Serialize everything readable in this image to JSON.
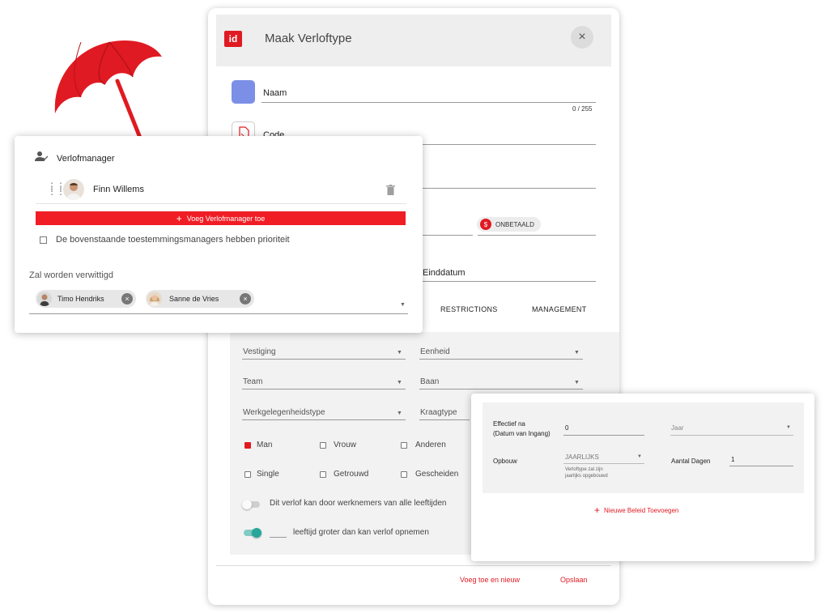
{
  "dialog": {
    "brand": "id",
    "title": "Maak Verloftype",
    "close_icon": "×",
    "naam_label": "Naam",
    "naam_counter": "0 / 255",
    "code_label": "Code",
    "unpaid_label": "ONBETAALD",
    "unpaid_icon": "$",
    "end_date_label": "Einddatum",
    "tabs": {
      "restrictions": "RESTRICTIONS",
      "management": "MANAGEMENT"
    },
    "filters": {
      "vestiging": "Vestiging",
      "eenheid": "Eenheid",
      "team": "Team",
      "baan": "Baan",
      "werkgelegenheidstype": "Werkgelegenheidstype",
      "kraagtype": "Kraagtype"
    },
    "gender": {
      "man": "Man",
      "vrouw": "Vrouw",
      "anderen": "Anderen"
    },
    "marital": {
      "single": "Single",
      "getrouwd": "Getrouwd",
      "gescheiden": "Gescheiden"
    },
    "toggle_all_ages": "Dit verlof kan door werknemers van alle leeftijden",
    "toggle_age_limit": "leeftijd groter dan kan verlof opnemen",
    "footer": {
      "add_new": "Voeg toe en nieuw",
      "save": "Opslaan"
    }
  },
  "managers_card": {
    "title": "Verlofmanager",
    "manager_name": "Finn Willems",
    "add_button": "Voeg Verlofmanager toe",
    "add_icon": "+",
    "priority_label": "De bovenstaande toestemmingsmanagers hebben prioriteit",
    "notify_label": "Zal worden verwittigd",
    "notify_chips": [
      {
        "name": "Timo Hendriks"
      },
      {
        "name": "Sanne de Vries"
      }
    ],
    "chip_remove_icon": "×"
  },
  "policy_card": {
    "effective_label_1": "Effectief na",
    "effective_label_2": "(Datum van Ingang)",
    "effective_value": "0",
    "period_select": "Jaar",
    "buildup_label": "Opbouw",
    "buildup_select": "JAARLIJKS",
    "buildup_hint_1": "Verloftype zal zijn",
    "buildup_hint_2": "jaarlijks opgebouwd",
    "days_label": "Aantal Dagen",
    "days_value": "1",
    "new_policy": "Nieuwe Beleid Toevoegen",
    "new_policy_icon": "+"
  },
  "colors": {
    "accent": "#e01a22",
    "swatch": "#7b8fe6",
    "toggle_on": "#26a69a"
  }
}
